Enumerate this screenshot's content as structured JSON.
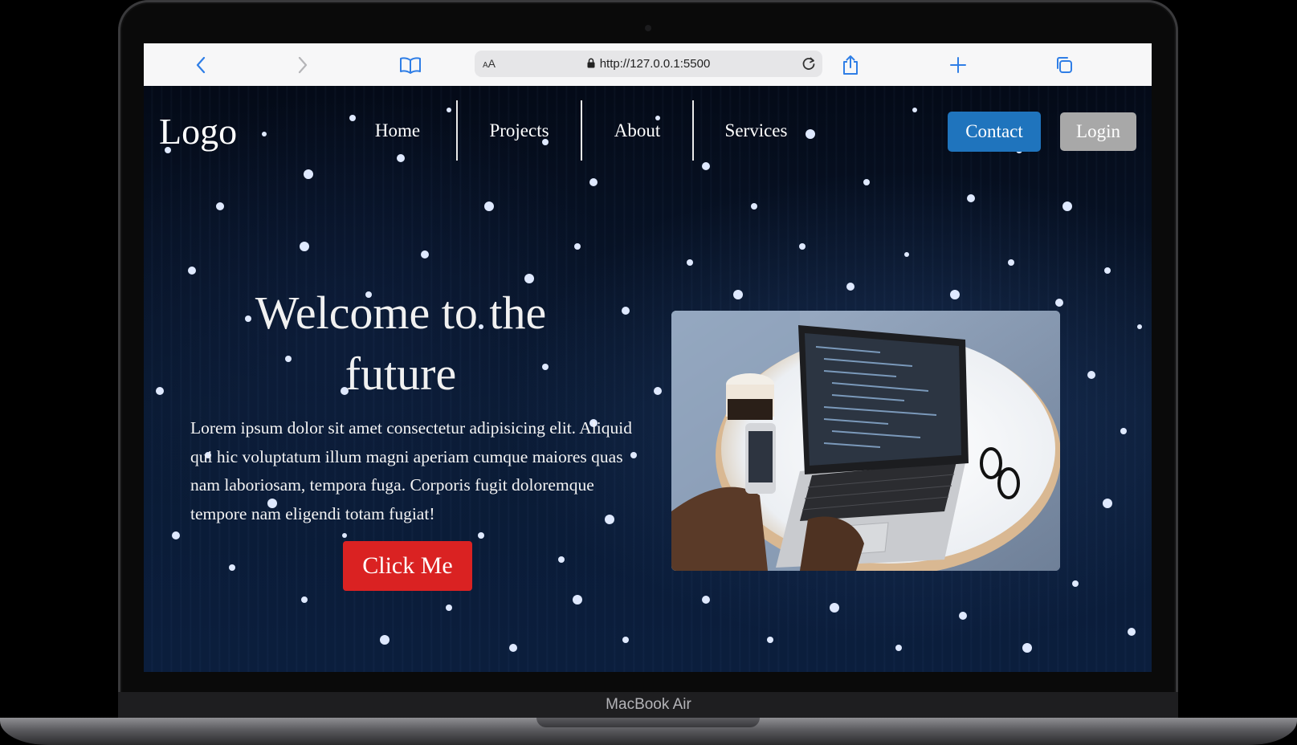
{
  "device": {
    "label": "MacBook Air"
  },
  "browser": {
    "text_size_label_small": "A",
    "text_size_label_large": "A",
    "url": "http://127.0.0.1:5500",
    "icons": [
      "back-icon",
      "forward-icon",
      "bookmarks-icon",
      "lock-icon",
      "reload-icon",
      "share-icon",
      "new-tab-icon",
      "tabs-icon"
    ]
  },
  "site": {
    "logo": "Logo",
    "nav": [
      {
        "label": "Home"
      },
      {
        "label": "Projects"
      },
      {
        "label": "About"
      },
      {
        "label": "Services"
      }
    ],
    "contact_label": "Contact",
    "login_label": "Login",
    "hero": {
      "title": "Welcome to the future",
      "text": "Lorem ipsum dolor sit amet consectetur adipisicing elit. Aliquid qui hic voluptatum illum magni aperiam cumque maiores quas nam laboriosam, tempora fuga. Corporis fugit doloremque tempore nam eligendi totam fugiat!",
      "button_label": "Click Me"
    },
    "colors": {
      "contact": "#1f74bd",
      "login": "#a8a8a8",
      "click_me": "#da2222",
      "browser_accent": "#2f7ee6"
    }
  }
}
